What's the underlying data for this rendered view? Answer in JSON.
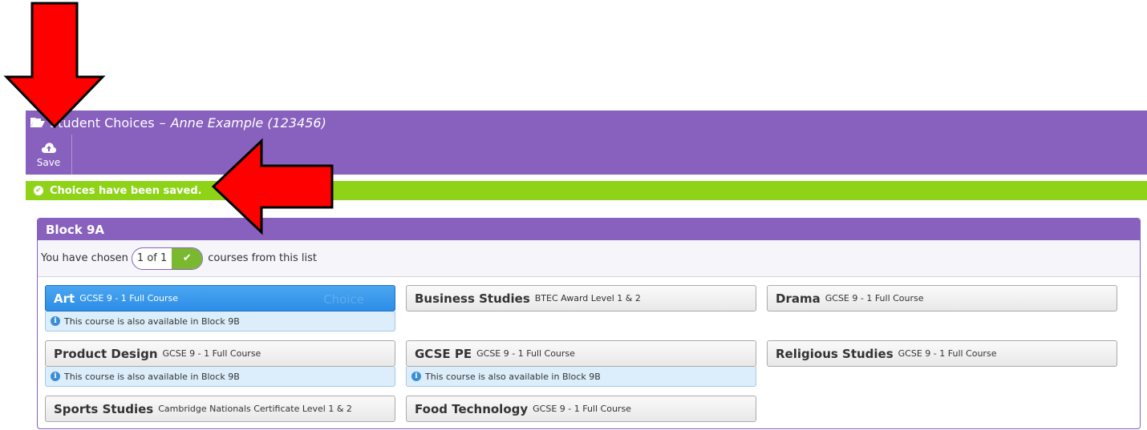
{
  "header": {
    "title": "Student Choices",
    "separator": "–",
    "student": "Anne Example (123456)"
  },
  "toolbar": {
    "save_label": "Save"
  },
  "notice": {
    "text": "Choices have been saved."
  },
  "block": {
    "title": "Block 9A",
    "chosen_prefix": "You have chosen",
    "chosen_count": "1 of 1",
    "chosen_suffix": "courses from this list"
  },
  "courses": [
    {
      "name": "Art",
      "level": "GCSE 9 - 1 Full Course",
      "info": "This course is also available in Block 9B",
      "selected_badge": "Choice"
    },
    {
      "name": "Business Studies",
      "level": "BTEC Award Level 1 & 2"
    },
    {
      "name": "Drama",
      "level": "GCSE 9 - 1 Full Course"
    },
    {
      "name": "Product Design",
      "level": "GCSE 9 - 1 Full Course",
      "info": "This course is also available in Block 9B"
    },
    {
      "name": "GCSE PE",
      "level": "GCSE 9 - 1 Full Course",
      "info": "This course is also available in Block 9B"
    },
    {
      "name": "Religious Studies",
      "level": "GCSE 9 - 1 Full Course"
    },
    {
      "name": "Sports Studies",
      "level": "Cambridge Nationals Certificate Level 1 & 2"
    },
    {
      "name": "Food Technology",
      "level": "GCSE 9 - 1 Full Course"
    }
  ],
  "colors": {
    "header": "#8860bd",
    "success": "#8ed317",
    "selected": "#2d8ee8",
    "annotation_arrow": "#ff0000"
  }
}
